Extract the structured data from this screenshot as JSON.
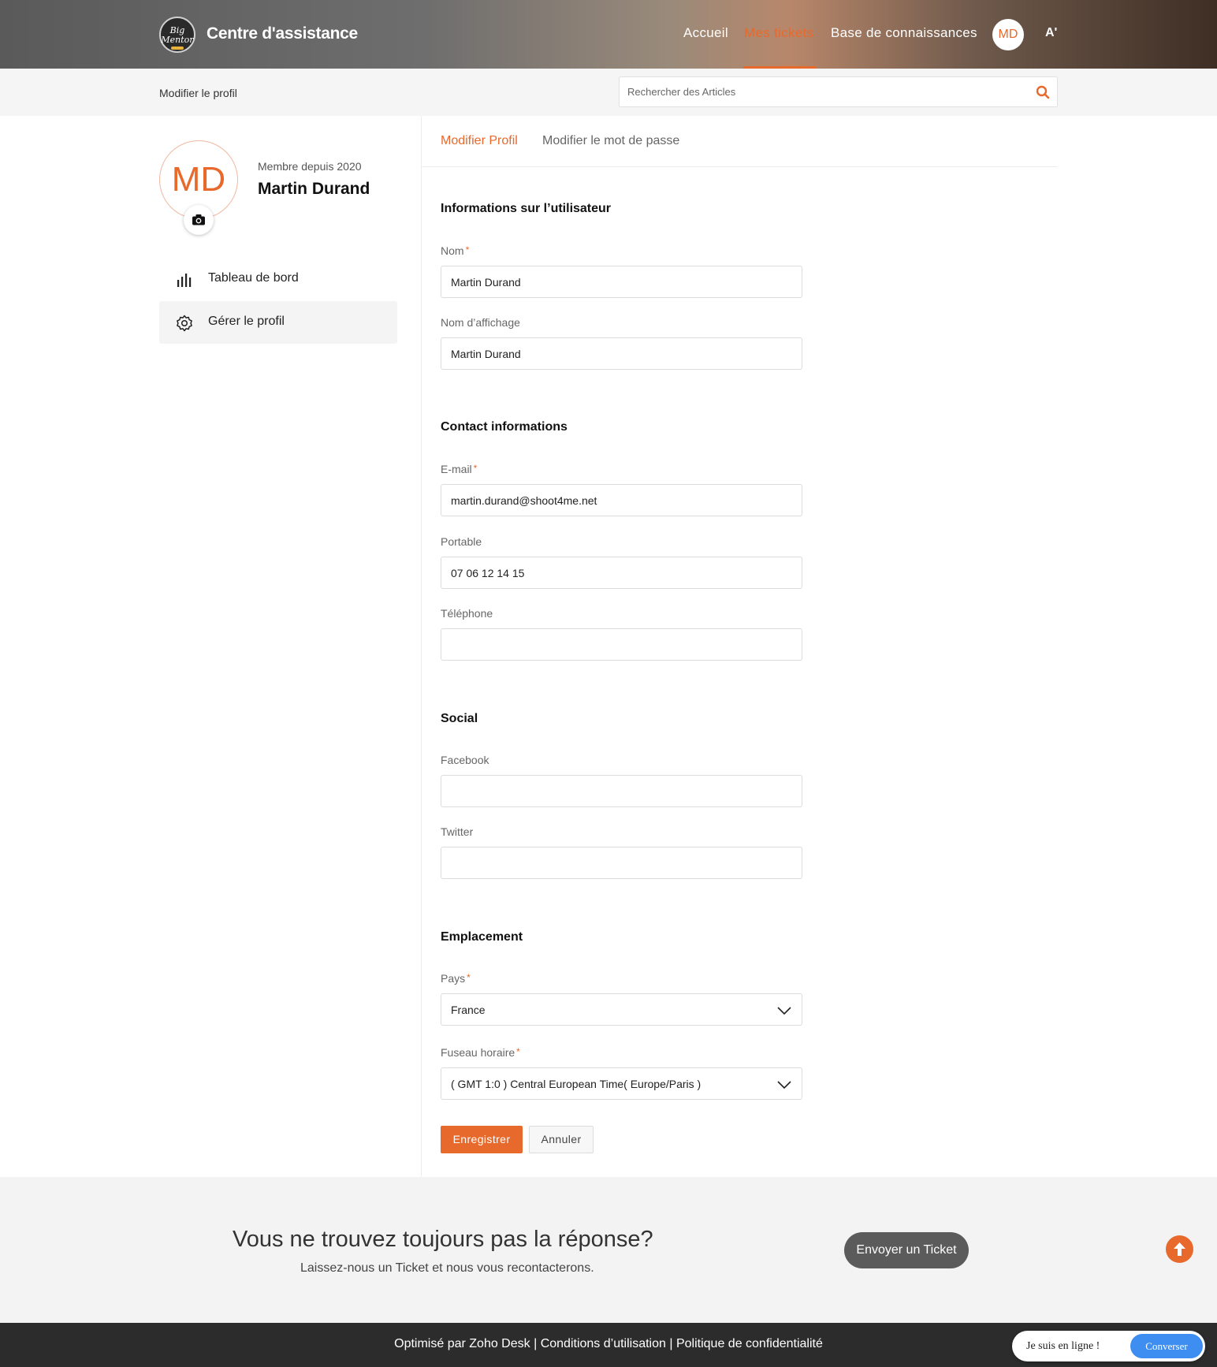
{
  "header": {
    "logo_text": "Big Mentor",
    "title": "Centre d'assistance",
    "nav": [
      "Accueil",
      "Mes tickets",
      "Base de connaissances"
    ],
    "active_nav": "Mes tickets",
    "avatar_initials": "MD",
    "accessibility_label": "A'"
  },
  "subbar": {
    "breadcrumb": "Modifier le profil",
    "search_placeholder": "Rechercher des Articles"
  },
  "profile": {
    "initials": "MD",
    "member_since": "Membre depuis 2020",
    "name": "Martin Durand"
  },
  "sidebar": {
    "items": [
      {
        "label": "Tableau de bord",
        "icon": "bar-chart-icon"
      },
      {
        "label": "Gérer le profil",
        "icon": "gear-icon",
        "active": true
      }
    ]
  },
  "tabs": [
    "Modifier Profil",
    "Modifier le mot de passe"
  ],
  "form": {
    "user_section": "Informations sur l’utilisateur",
    "name_label": "Nom",
    "name_value": "Martin Durand",
    "display_label": "Nom d’affichage",
    "display_value": "Martin Durand",
    "contact_section": "Contact informations",
    "email_label": "E-mail",
    "email_value": "martin.durand@shoot4me.net",
    "mobile_label": "Portable",
    "mobile_value": "07 06 12 14 15",
    "phone_label": "Téléphone",
    "phone_value": "",
    "social_section": "Social",
    "facebook_label": "Facebook",
    "facebook_value": "",
    "twitter_label": "Twitter",
    "twitter_value": "",
    "location_section": "Emplacement",
    "country_label": "Pays",
    "country_value": "France",
    "timezone_label": "Fuseau horaire",
    "timezone_value": "( GMT 1:0 ) Central European Time( Europe/Paris )",
    "required_mark": "*",
    "save_label": "Enregistrer",
    "cancel_label": "Annuler"
  },
  "cta": {
    "title": "Vous ne trouvez toujours pas la réponse?",
    "subtitle": "Laissez-nous un Ticket et nous vous recontacterons.",
    "button": "Envoyer un Ticket"
  },
  "footer": {
    "link1": "Optimisé par Zoho Desk",
    "link2": "Conditions d’utilisation",
    "link3": "Politique de confidentialité",
    "separator": "|",
    "chat_status": "Je suis en ligne !",
    "chat_button": "Converser"
  },
  "colors": {
    "accent": "#e8692c",
    "chat_blue": "#3d8ef0",
    "footer_bg": "#2c2c2c"
  }
}
